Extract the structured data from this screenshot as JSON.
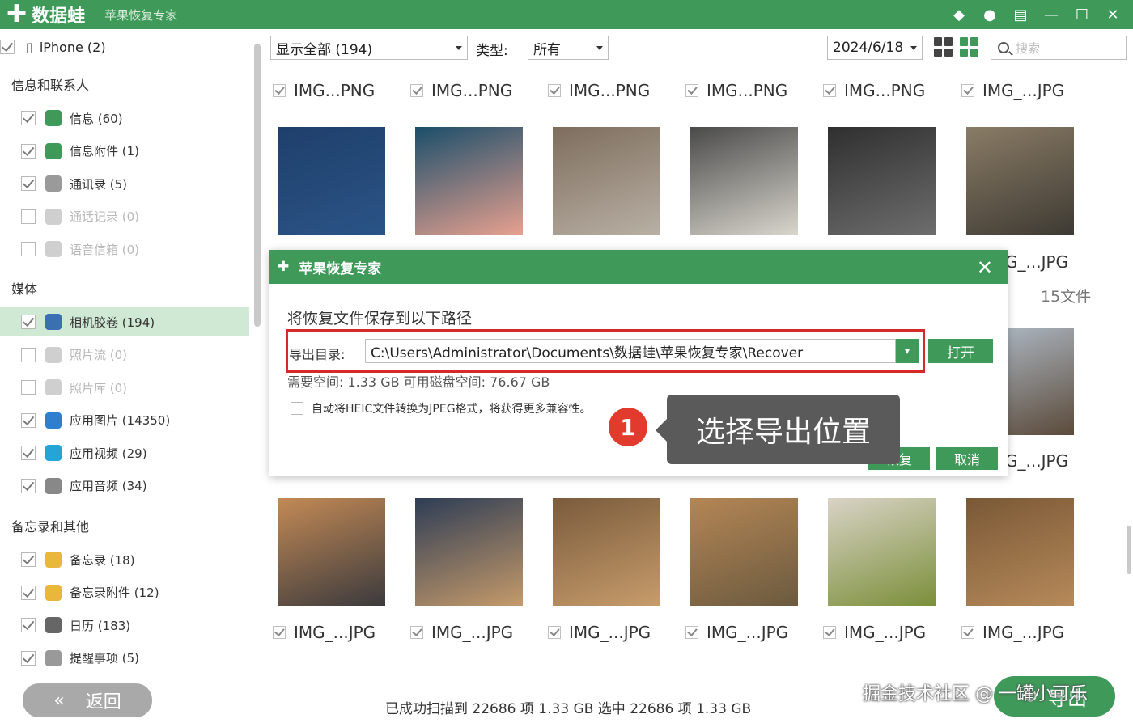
{
  "titlebar": {
    "app_name": "数据蛙",
    "subtitle": "苹果恢复专家",
    "icons": [
      "gem-icon",
      "chat-icon",
      "feedback-icon",
      "minimize-icon",
      "maximize-icon",
      "close-icon"
    ]
  },
  "sidebar": {
    "device": "iPhone (2)",
    "section_contacts": "信息和联系人",
    "contacts_items": [
      {
        "label": "信息 (60)",
        "checked": true,
        "icon": "message-icon",
        "color": "#3f9a5a"
      },
      {
        "label": "信息附件 (1)",
        "checked": true,
        "icon": "attachment-icon",
        "color": "#3f9a5a"
      },
      {
        "label": "通讯录 (5)",
        "checked": true,
        "icon": "contacts-icon",
        "color": "#9a9a9a"
      },
      {
        "label": "通话记录 (0)",
        "checked": false,
        "icon": "phone-icon",
        "color": "#3f9a5a"
      },
      {
        "label": "语音信箱 (0)",
        "checked": false,
        "icon": "voicemail-icon",
        "color": "#777777"
      }
    ],
    "section_media": "媒体",
    "media_items": [
      {
        "label": "相机胶卷 (194)",
        "checked": true,
        "icon": "camera-roll-icon",
        "color": "#3a6fb0"
      },
      {
        "label": "照片流 (0)",
        "checked": false,
        "icon": "photo-stream-icon",
        "color": "#333333"
      },
      {
        "label": "照片库 (0)",
        "checked": false,
        "icon": "photo-library-icon",
        "color": "#e0882a"
      },
      {
        "label": "应用图片 (14350)",
        "checked": true,
        "icon": "app-photo-icon",
        "color": "#2f7fd0"
      },
      {
        "label": "应用视频 (29)",
        "checked": true,
        "icon": "app-video-icon",
        "color": "#25a4d8"
      },
      {
        "label": "应用音频 (34)",
        "checked": true,
        "icon": "app-audio-icon",
        "color": "#888888"
      }
    ],
    "section_memo": "备忘录和其他",
    "memo_items": [
      {
        "label": "备忘录 (18)",
        "checked": true,
        "icon": "notes-icon",
        "color": "#e8b83a"
      },
      {
        "label": "备忘录附件 (12)",
        "checked": true,
        "icon": "notes-attachment-icon",
        "color": "#e8b83a"
      },
      {
        "label": "日历 (183)",
        "checked": true,
        "icon": "calendar-icon",
        "color": "#666666"
      },
      {
        "label": "提醒事项 (5)",
        "checked": true,
        "icon": "reminder-icon",
        "color": "#999999"
      }
    ],
    "back_label": "返回"
  },
  "toolbar": {
    "filter_value": "显示全部 (194)",
    "type_label": "类型:",
    "type_value": "所有",
    "date_value": "2024/6/18",
    "search_placeholder": "搜索"
  },
  "grid": {
    "row1_labels": [
      "IMG...PNG",
      "IMG...PNG",
      "IMG...PNG",
      "IMG...PNG",
      "IMG...PNG",
      "IMG_...JPG"
    ],
    "row2_right_label": "G_...JPG",
    "row2_count": "15文件",
    "row3_right_label": "G_...JPG",
    "row4_labels": [
      "IMG_...JPG",
      "IMG_...JPG",
      "IMG_...JPG",
      "IMG_...JPG",
      "IMG_...JPG",
      "IMG_...JPG"
    ]
  },
  "dialog": {
    "title": "苹果恢复专家",
    "prompt": "将恢复文件保存到以下路径",
    "path_label": "导出目录:",
    "path_value": "C:\\Users\\Administrator\\Documents\\数据蛙\\苹果恢复专家\\Recover",
    "open_label": "打开",
    "space_info": "需要空间: 1.33 GB   可用磁盘空间: 76.67 GB",
    "heic_option": "自动将HEIC文件转换为JPEG格式，将获得更多兼容性。",
    "ok_label": "恢复",
    "cancel_label": "取消"
  },
  "callout": {
    "badge": "1",
    "text": "选择导出位置"
  },
  "status": {
    "text": "已成功扫描到 22686 项 1.33 GB  选中 22686 项 1.33 GB",
    "export_label": "导出"
  },
  "watermark": "掘金技术社区 @ 一罐小可乐",
  "colors": {
    "brand_green": "#3f9a5a",
    "highlight_red": "#d42a2a",
    "active_row": "#cfe9d5"
  }
}
